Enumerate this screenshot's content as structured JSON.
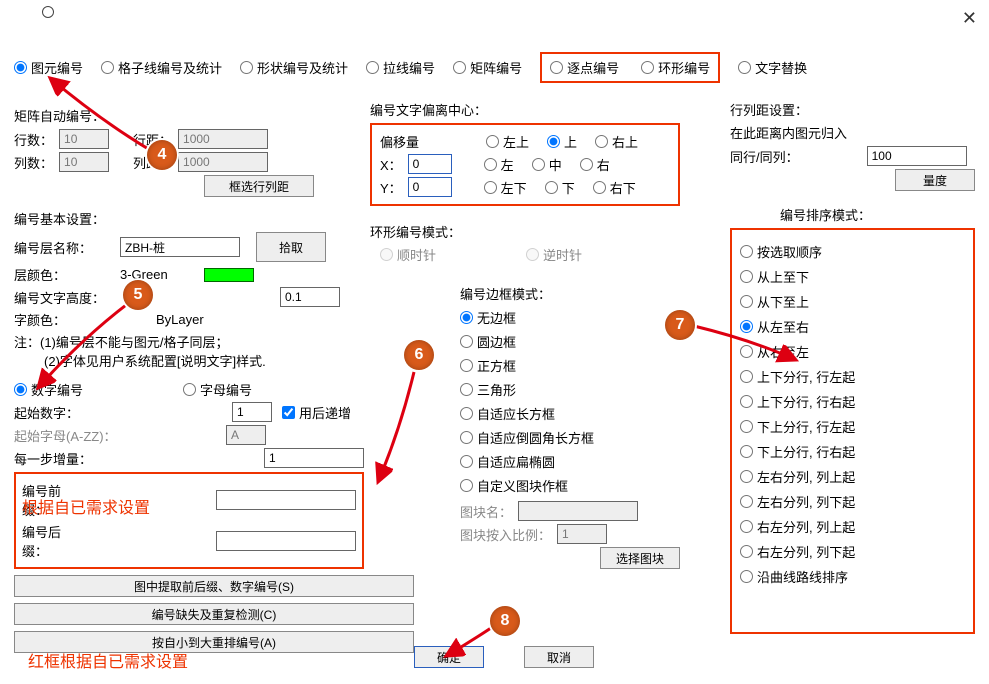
{
  "close_icon": "✕",
  "tabs": {
    "t1": "图元编号",
    "t2": "格子线编号及统计",
    "t3": "形状编号及统计",
    "t4": "拉线编号",
    "t5": "矩阵编号",
    "t6": "逐点编号",
    "t7": "环形编号",
    "t8": "文字替换"
  },
  "autoNum": {
    "title": "矩阵自动编号：",
    "rows_lbl": "行数：",
    "rows_val": "10",
    "rowd_lbl": "行距：",
    "rowd_val": "1000",
    "cols_lbl": "列数：",
    "cols_val": "10",
    "cold_lbl": "列距：",
    "cold_val": "1000",
    "btn": "框选行列距"
  },
  "offset": {
    "title": "编号文字偏离中心：",
    "amt_lbl": "偏移量",
    "x_lbl": "X：",
    "x_val": "0",
    "y_lbl": "Y：",
    "y_val": "0",
    "p": {
      "lt": "左上",
      "t": "上",
      "rt": "右上",
      "l": "左",
      "c": "中",
      "r": "右",
      "lb": "左下",
      "b": "下",
      "rb": "右下"
    }
  },
  "lineDist": {
    "title": "行列距设置：",
    "desc": "在此距离内图元归入",
    "row_lbl": "同行/同列：",
    "row_val": "100",
    "btn": "量度"
  },
  "base": {
    "title": "编号基本设置：",
    "layer_lbl": "编号层名称：",
    "layer_val": "ZBH-桩",
    "pick_btn": "拾取",
    "color_lbl": "层颜色：",
    "color_name": "3-Green",
    "textH_lbl": "编号文字高度：",
    "textH_val": "0.1",
    "fontC_lbl": "字颜色：",
    "fontC_val": "ByLayer",
    "note1": "注：(1)编号层不能与图元/格子同层；",
    "note2": "(2)字体见用户系统配置[说明文字]样式.",
    "num_radio": "数字编号",
    "alpha_radio": "字母编号",
    "start_num_lbl": "起始数字：",
    "start_num_val": "1",
    "incr_cb": "用后递增",
    "start_alpha_lbl": "起始字母(A-ZZ)：",
    "start_alpha_val": "A",
    "step_lbl": "每一步增量：",
    "step_val": "1",
    "prefix_lbl": "编号前缀：",
    "suffix_lbl": "编号后缀：",
    "red_note": "根据自已需求设置",
    "btn_extract": "图中提取前后缀、数字编号(S)",
    "btn_check": "编号缺失及重复检测(C)",
    "btn_sort": "按自小到大重排编号(A)"
  },
  "ring": {
    "title": "环形编号模式：",
    "cw": "顺时针",
    "ccw": "逆时针"
  },
  "border": {
    "title": "编号边框模式：",
    "opts": [
      "无边框",
      "圆边框",
      "正方框",
      "三角形",
      "自适应长方框",
      "自适应倒圆角长方框",
      "自适应扁椭圆",
      "自定义图块作框"
    ],
    "blk_lbl": "图块名：",
    "scale_lbl": "图块按入比例：",
    "scale_val": "1",
    "pick_btn": "选择图块"
  },
  "sort": {
    "title": "编号排序模式：",
    "opts": [
      "按选取顺序",
      "从上至下",
      "从下至上",
      "从左至右",
      "从右至左",
      "上下分行, 行左起",
      "上下分行, 行右起",
      "下上分行, 行左起",
      "下上分行, 行右起",
      "左右分列, 列上起",
      "左右分列, 列下起",
      "右左分列, 列上起",
      "右左分列, 列下起",
      "沿曲线路线排序"
    ],
    "selected": 3
  },
  "badges": {
    "b4": "4",
    "b5": "5",
    "b6": "6",
    "b7": "7",
    "b8": "8"
  },
  "footer": {
    "ok": "确定",
    "cancel": "取消",
    "red": "红框根据自已需求设置"
  }
}
